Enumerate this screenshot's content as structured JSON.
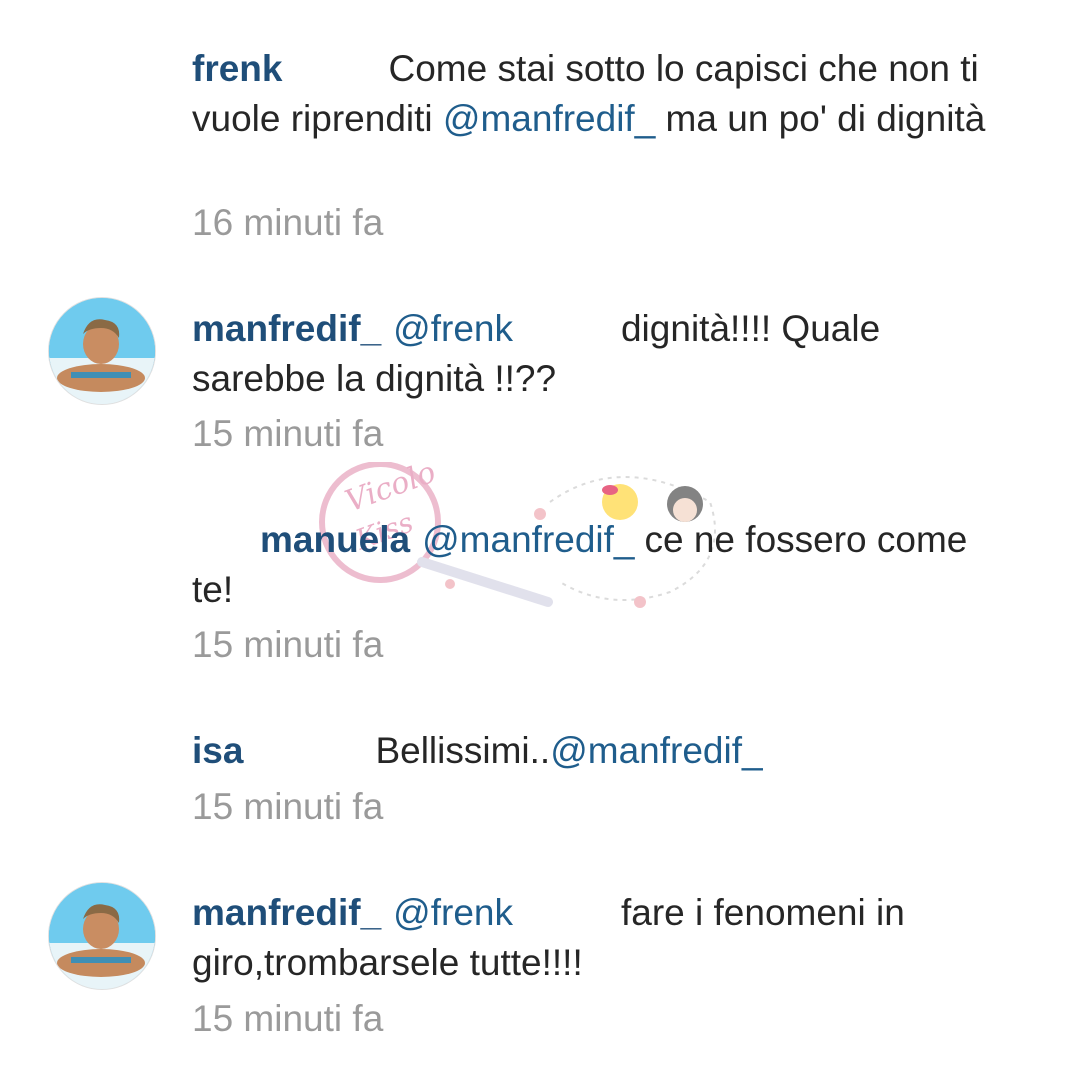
{
  "comments": [
    {
      "username": "frenk",
      "mention": "",
      "text_before": "Come stai sotto lo capisci che non ti vuole riprenditi ",
      "text_mention": "@manfredif_",
      "text_after": "  ma un po' di dignità",
      "time": "16 minuti fa",
      "has_avatar": false
    },
    {
      "username": "manfredif_",
      "mention": "@frenk",
      "text_before": "dignità!!!! Quale sarebbe la dignità !!??",
      "text_mention": "",
      "text_after": "",
      "time": "15 minuti fa",
      "has_avatar": true
    },
    {
      "username": "manuela",
      "mention": "@manfredif_",
      "text_before": "ce ne fossero come te!",
      "text_mention": "",
      "text_after": "",
      "time": "15 minuti fa",
      "has_avatar": false
    },
    {
      "username": "isa",
      "mention": "",
      "text_before": "Bellissimi..",
      "text_mention": "@manfredif_",
      "text_after": "",
      "time": "15 minuti fa",
      "has_avatar": false
    },
    {
      "username": "manfredif_",
      "mention": "@frenk",
      "text_before": "fare i fenomeni in giro,trombarsele tutte!!!!",
      "text_mention": "",
      "text_after": "",
      "time": "15 minuti fa",
      "has_avatar": true
    }
  ],
  "watermark": {
    "text": "Vicolo Kiss"
  },
  "colors": {
    "username": "#1f4e79",
    "mention": "#1f5d8c",
    "text": "#262626",
    "time": "#9a9a9a"
  }
}
